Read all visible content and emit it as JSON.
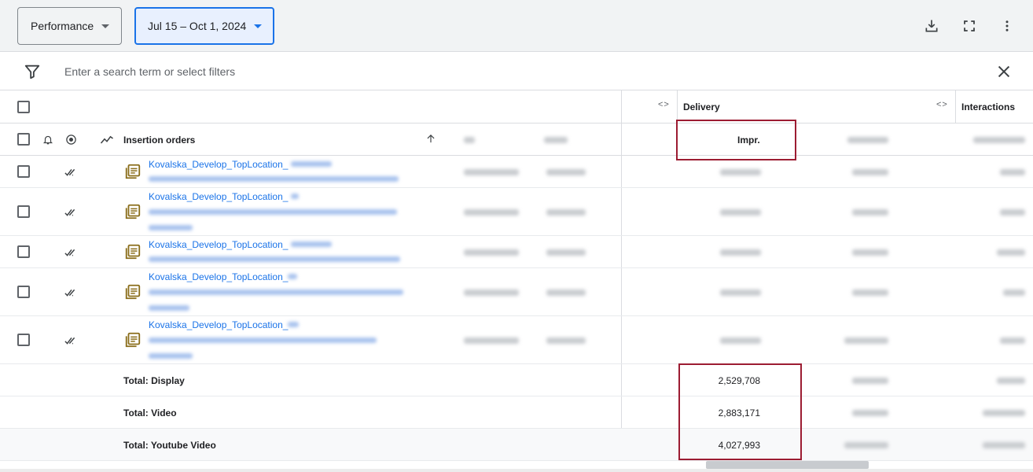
{
  "toolbar": {
    "report_dropdown": "Performance",
    "date_dropdown": "Jul 15 – Oct 1, 2024",
    "download_icon": "download-icon",
    "fullscreen_icon": "fullscreen-icon",
    "more_icon": "more-vert-icon"
  },
  "filter": {
    "placeholder": "Enter a search term or select filters"
  },
  "table": {
    "group_headers": {
      "delivery": "Delivery",
      "interactions": "Interactions"
    },
    "column_headers": {
      "insertion_orders": "Insertion orders",
      "impr": "Impr."
    },
    "rows": [
      {
        "name": "Kovalska_Develop_TopLocation_"
      },
      {
        "name": "Kovalska_Develop_TopLocation_"
      },
      {
        "name": "Kovalska_Develop_TopLocation_"
      },
      {
        "name": "Kovalska_Develop_TopLocation_"
      },
      {
        "name": "Kovalska_Develop_TopLocation_"
      }
    ],
    "totals": [
      {
        "label": "Total: Display",
        "impr": "2,529,708"
      },
      {
        "label": "Total: Video",
        "impr": "2,883,171"
      },
      {
        "label": "Total: Youtube Video",
        "impr": "4,027,993"
      }
    ]
  },
  "colors": {
    "accent": "#1a73e8",
    "highlight": "#9c1c32"
  }
}
